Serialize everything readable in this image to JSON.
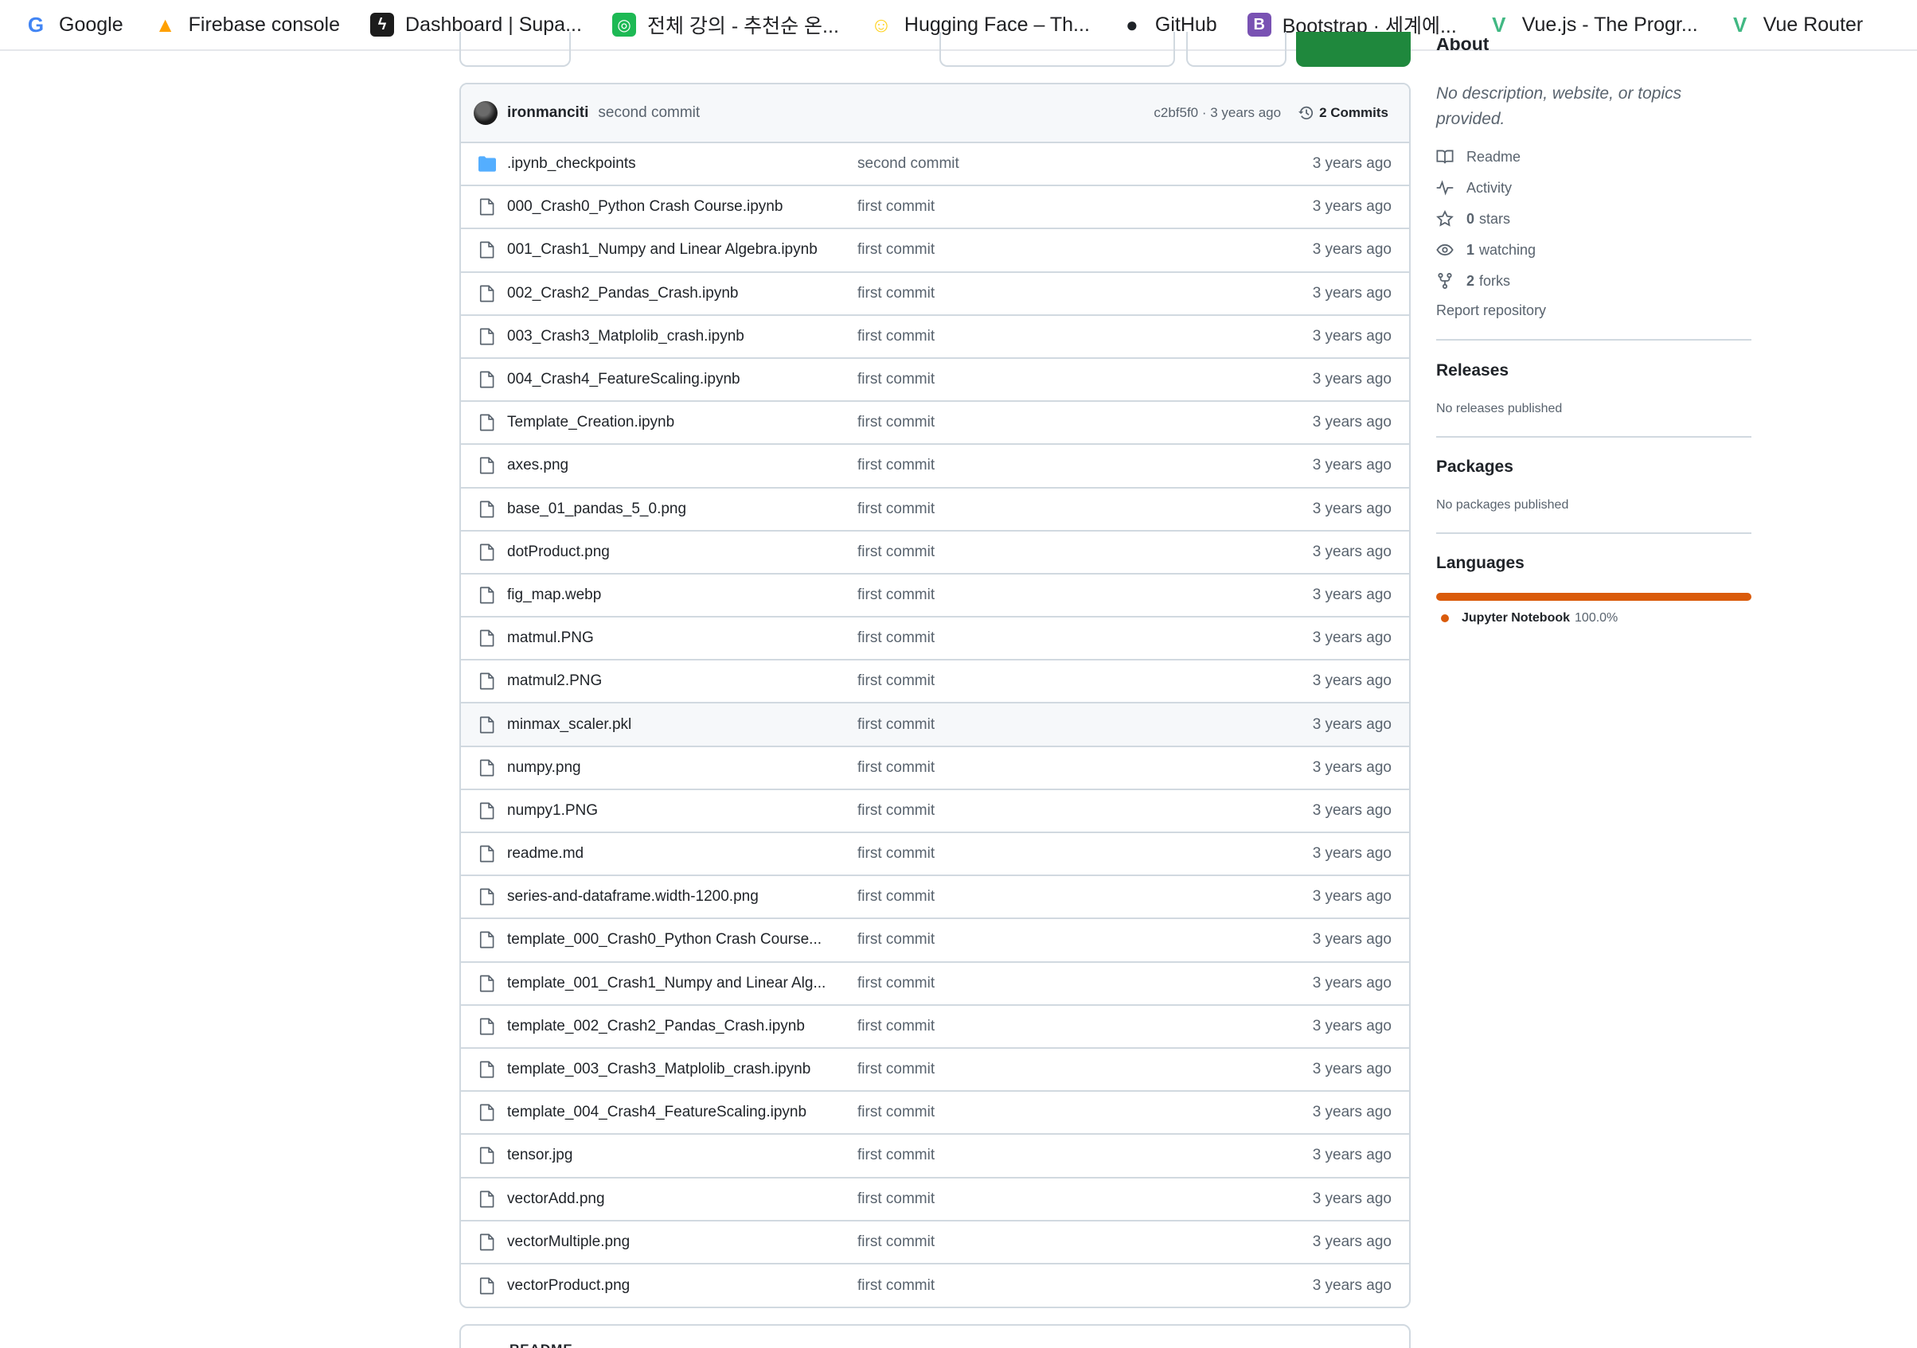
{
  "bookmarks": [
    {
      "label": "Google",
      "icon": "google-icon",
      "color": "#4285F4"
    },
    {
      "label": "Firebase console",
      "icon": "firebase-icon",
      "color": "#FFA000"
    },
    {
      "label": "Dashboard | Supa...",
      "icon": "supabase-icon",
      "color": "#1c1c1c"
    },
    {
      "label": "전체 강의 - 추천순 온...",
      "icon": "course-site-icon",
      "color": "#1db954"
    },
    {
      "label": "Hugging Face – Th...",
      "icon": "hugging-face-icon",
      "color": "#FFD21E"
    },
    {
      "label": "GitHub",
      "icon": "github-icon",
      "color": "#1f2328"
    },
    {
      "label": "Bootstrap · 세계에...",
      "icon": "bootstrap-icon",
      "color": "#7952b3"
    },
    {
      "label": "Vue.js - The Progr...",
      "icon": "vue-icon",
      "color": "#41b883"
    },
    {
      "label": "Vue Router",
      "icon": "vue-router-icon",
      "color": "#41b883"
    }
  ],
  "commit": {
    "author": "ironmanciti",
    "message": "second commit",
    "meta": "c2bf5f0 · 3 years ago",
    "commits_label": "2 Commits"
  },
  "files": [
    {
      "name": ".ipynb_checkpoints",
      "type": "folder",
      "commit": "second commit",
      "date": "3 years ago"
    },
    {
      "name": "000_Crash0_Python Crash Course.ipynb",
      "type": "file",
      "commit": "first commit",
      "date": "3 years ago"
    },
    {
      "name": "001_Crash1_Numpy and Linear Algebra.ipynb",
      "type": "file",
      "commit": "first commit",
      "date": "3 years ago"
    },
    {
      "name": "002_Crash2_Pandas_Crash.ipynb",
      "type": "file",
      "commit": "first commit",
      "date": "3 years ago"
    },
    {
      "name": "003_Crash3_Matplolib_crash.ipynb",
      "type": "file",
      "commit": "first commit",
      "date": "3 years ago"
    },
    {
      "name": "004_Crash4_FeatureScaling.ipynb",
      "type": "file",
      "commit": "first commit",
      "date": "3 years ago"
    },
    {
      "name": "Template_Creation.ipynb",
      "type": "file",
      "commit": "first commit",
      "date": "3 years ago"
    },
    {
      "name": "axes.png",
      "type": "file",
      "commit": "first commit",
      "date": "3 years ago"
    },
    {
      "name": "base_01_pandas_5_0.png",
      "type": "file",
      "commit": "first commit",
      "date": "3 years ago"
    },
    {
      "name": "dotProduct.png",
      "type": "file",
      "commit": "first commit",
      "date": "3 years ago"
    },
    {
      "name": "fig_map.webp",
      "type": "file",
      "commit": "first commit",
      "date": "3 years ago"
    },
    {
      "name": "matmul.PNG",
      "type": "file",
      "commit": "first commit",
      "date": "3 years ago"
    },
    {
      "name": "matmul2.PNG",
      "type": "file",
      "commit": "first commit",
      "date": "3 years ago"
    },
    {
      "name": "minmax_scaler.pkl",
      "type": "file",
      "commit": "first commit",
      "date": "3 years ago",
      "hover": true
    },
    {
      "name": "numpy.png",
      "type": "file",
      "commit": "first commit",
      "date": "3 years ago"
    },
    {
      "name": "numpy1.PNG",
      "type": "file",
      "commit": "first commit",
      "date": "3 years ago"
    },
    {
      "name": "readme.md",
      "type": "file",
      "commit": "first commit",
      "date": "3 years ago"
    },
    {
      "name": "series-and-dataframe.width-1200.png",
      "type": "file",
      "commit": "first commit",
      "date": "3 years ago"
    },
    {
      "name": "template_000_Crash0_Python Crash Course...",
      "type": "file",
      "commit": "first commit",
      "date": "3 years ago"
    },
    {
      "name": "template_001_Crash1_Numpy and Linear Alg...",
      "type": "file",
      "commit": "first commit",
      "date": "3 years ago"
    },
    {
      "name": "template_002_Crash2_Pandas_Crash.ipynb",
      "type": "file",
      "commit": "first commit",
      "date": "3 years ago"
    },
    {
      "name": "template_003_Crash3_Matplolib_crash.ipynb",
      "type": "file",
      "commit": "first commit",
      "date": "3 years ago"
    },
    {
      "name": "template_004_Crash4_FeatureScaling.ipynb",
      "type": "file",
      "commit": "first commit",
      "date": "3 years ago"
    },
    {
      "name": "tensor.jpg",
      "type": "file",
      "commit": "first commit",
      "date": "3 years ago"
    },
    {
      "name": "vectorAdd.png",
      "type": "file",
      "commit": "first commit",
      "date": "3 years ago"
    },
    {
      "name": "vectorMultiple.png",
      "type": "file",
      "commit": "first commit",
      "date": "3 years ago"
    },
    {
      "name": "vectorProduct.png",
      "type": "file",
      "commit": "first commit",
      "date": "3 years ago"
    }
  ],
  "sidebar": {
    "about_title": "About",
    "description": "No description, website, or topics provided.",
    "readme": "Readme",
    "activity": "Activity",
    "stars_count": "0",
    "stars_label": "stars",
    "watching_count": "1",
    "watching_label": "watching",
    "forks_count": "2",
    "forks_label": "forks",
    "report": "Report repository",
    "releases_title": "Releases",
    "releases_sub": "No releases published",
    "packages_title": "Packages",
    "packages_sub": "No packages published",
    "languages_title": "Languages",
    "language": {
      "name": "Jupyter Notebook",
      "percent": "100.0%",
      "color": "#DA5B0B"
    }
  },
  "readme_label": "README"
}
